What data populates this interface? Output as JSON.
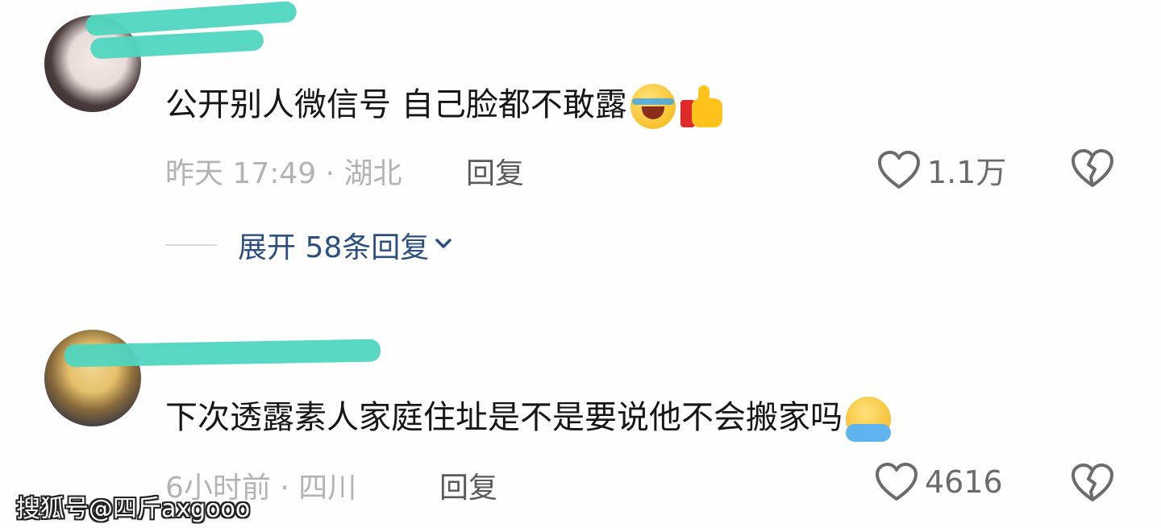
{
  "comments": [
    {
      "text": "公开别人微信号 自己脸都不敢露",
      "emojis": [
        "laughing-crying-emoji",
        "thumbs-up-emoji"
      ],
      "meta": "昨天 17:49 · 湖北",
      "reply_label": "回复",
      "likes": "1.1万",
      "expand_label": "展开 58条回复"
    },
    {
      "text": "下次透露素人家庭住址是不是要说他不会搬家吗",
      "emojis": [
        "hugging-face-emoji"
      ],
      "meta": "6小时前 · 四川",
      "reply_label": "回复",
      "likes": "4616"
    }
  ],
  "watermark": "搜狐号@四斤axgooo",
  "colors": {
    "name_redaction": "#4fd6bf",
    "expand_link": "#2c4f80",
    "meta_gray": "#b3b3b3"
  }
}
